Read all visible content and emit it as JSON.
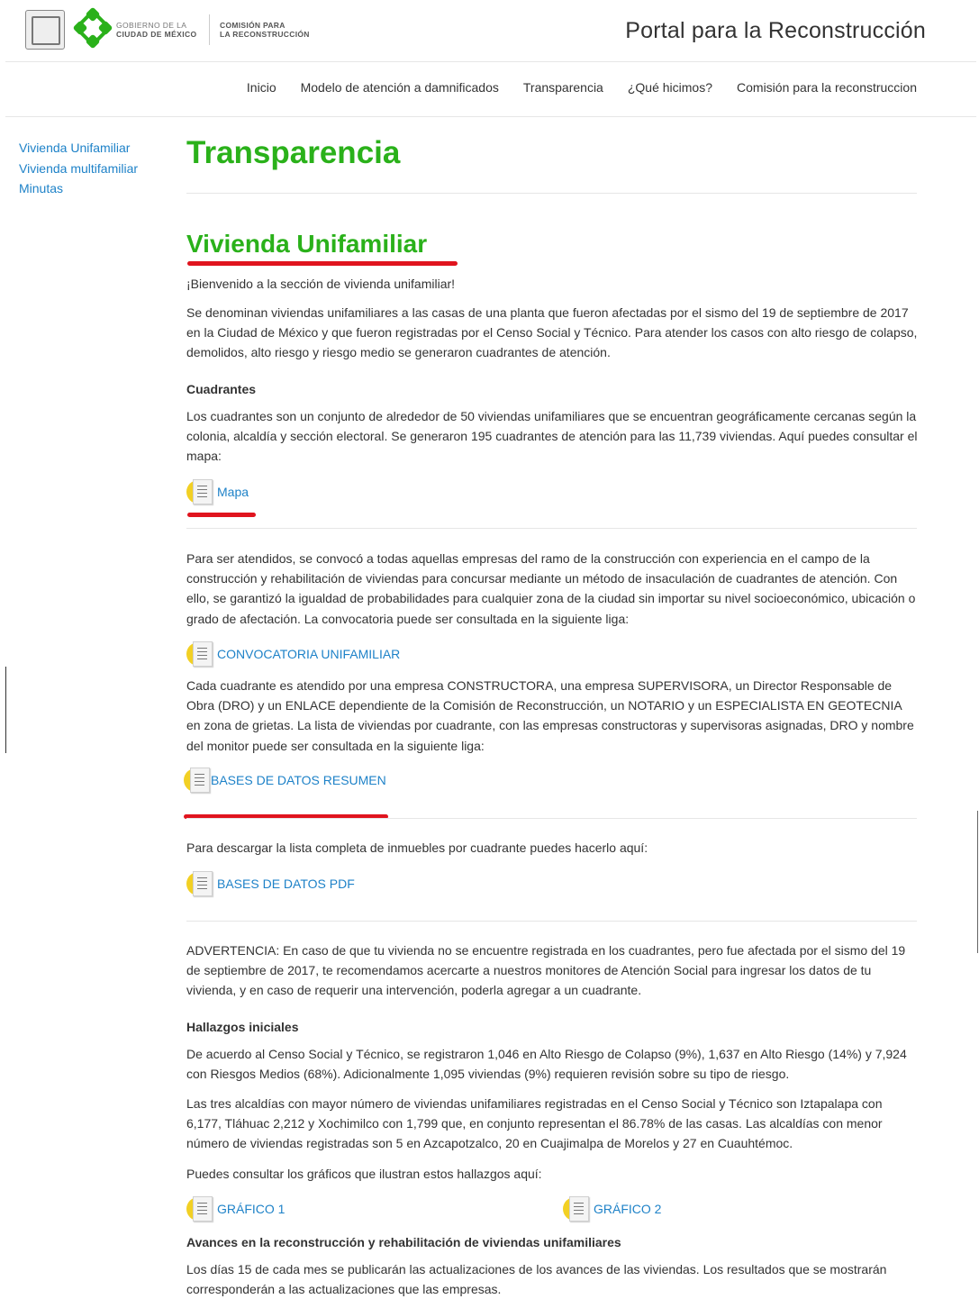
{
  "header": {
    "gov_line1": "GOBIERNO DE LA",
    "gov_line2": "CIUDAD DE MÉXICO",
    "com_line1": "COMISIÓN PARA",
    "com_line2": "LA RECONSTRUCCIÓN",
    "portal_title": "Portal para la Reconstrucción",
    "brand_green": "#2ab11a"
  },
  "nav": {
    "items": [
      "Inicio",
      "Modelo de atención a damnificados",
      "Transparencia",
      "¿Qué hicimos?",
      "Comisión para la reconstruccion"
    ]
  },
  "sidebar": {
    "items": [
      "Vivienda Unifamiliar",
      "Vivienda multifamiliar",
      "Minutas"
    ]
  },
  "main": {
    "page_title": "Transparencia",
    "section_title": "Vivienda Unifamiliar",
    "welcome": "¡Bienvenido a la sección de vivienda unifamiliar!",
    "intro": "Se denominan viviendas unifamiliares a las casas de una planta que fueron afectadas por el sismo del 19 de septiembre de 2017 en la Ciudad de México y que fueron registradas por el Censo Social y Técnico. Para atender los casos con alto riesgo de colapso, demolidos, alto riesgo y riesgo medio se generaron cuadrantes de atención.",
    "cuadrantes_heading": "Cuadrantes",
    "cuadrantes_text": "Los cuadrantes son un conjunto de alrededor de 50 viviendas unifamiliares que se encuentran geográficamente cercanas según la colonia, alcaldía y sección electoral. Se generaron 195 cuadrantes de atención para las 11,739 viviendas. Aquí puedes consultar el mapa:",
    "link_mapa": "Mapa",
    "convocatoria_text": "Para ser atendidos, se convocó a todas aquellas empresas del ramo de la construcción con experiencia en el campo de la construcción y rehabilitación de viviendas para concursar mediante un método de insaculación de cuadrantes de atención. Con ello, se garantizó la igualdad de probabilidades para cualquier zona de la ciudad sin importar su nivel socioeconómico, ubicación o grado de afectación. La convocatoria puede ser consultada en la siguiente liga:",
    "link_convocatoria": "CONVOCATORIA UNIFAMILIAR",
    "cuadrante_text": "Cada cuadrante es atendido por una empresa CONSTRUCTORA, una empresa SUPERVISORA, un Director Responsable de Obra (DRO) y un ENLACE dependiente de la Comisión de Reconstrucción, un NOTARIO y un ESPECIALISTA EN GEOTECNIA en zona de grietas. La lista de viviendas por cuadrante, con las empresas constructoras y supervisoras asignadas, DRO y nombre del monitor puede ser consultada en la siguiente liga:",
    "link_bases_resumen": "BASES DE DATOS RESUMEN",
    "descargar_text": "Para descargar la lista completa de inmuebles por cuadrante puedes hacerlo aquí:",
    "link_bases_pdf": "BASES DE DATOS PDF",
    "advertencia_text": "ADVERTENCIA: En caso de que tu vivienda no se encuentre registrada en los cuadrantes, pero fue afectada por el sismo del 19 de septiembre de 2017, te recomendamos acercarte a nuestros monitores de Atención Social para ingresar los datos de tu vivienda, y en caso de requerir una intervención, poderla agregar a un cuadrante.",
    "hallazgos_heading": "Hallazgos iniciales",
    "hallazgos_text1": "De acuerdo al Censo Social y Técnico, se registraron 1,046 en Alto Riesgo de Colapso (9%), 1,637 en Alto Riesgo (14%) y 7,924 con Riesgos Medios (68%). Adicionalmente 1,095 viviendas (9%) requieren revisión sobre su tipo de riesgo.",
    "hallazgos_text2": "Las tres alcaldías con mayor número de viviendas unifamiliares registradas en el Censo Social y Técnico son Iztapalapa con 6,177, Tláhuac 2,212 y Xochimilco con 1,799 que, en conjunto representan el 86.78% de las casas. Las alcaldías con menor número de viviendas registradas son 5 en Azcapotzalco, 20 en Cuajimalpa de Morelos y 27 en Cuauhtémoc.",
    "graficos_text": "Puedes consultar los gráficos que ilustran estos hallazgos aquí:",
    "link_grafico1": "GRÁFICO 1",
    "link_grafico2": "GRÁFICO 2",
    "avances_heading": "Avances en la reconstrucción y rehabilitación de viviendas unifamiliares",
    "avances_text": "Los días 15 de cada mes se publicarán las actualizaciones de los avances de las viviendas. Los resultados que se mostrarán corresponderán a las actualizaciones que las empresas."
  },
  "colors": {
    "link": "#1e82c8",
    "title_green": "#2ab11a",
    "annotation_red": "#e0141e",
    "icon_yellow": "#f2d024"
  }
}
